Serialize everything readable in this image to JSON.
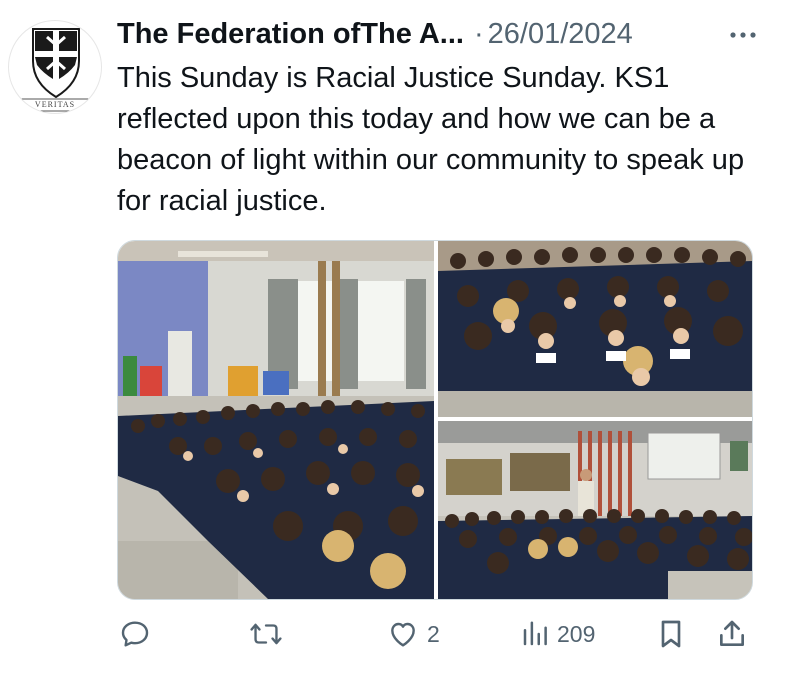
{
  "tweet": {
    "author": "The Federation ofThe A...",
    "separator": "·",
    "date": "26/01/2024",
    "text": "This Sunday is Racial Justice Sunday. KS1 reflected upon this today and how we can be a beacon of light within our community to speak up for racial justice.",
    "avatar": {
      "motto": "VERITAS",
      "icon": "dominican-shield-icon"
    }
  },
  "media": {
    "photos": [
      {
        "icon": "school-hall-photo"
      },
      {
        "icon": "children-praying-photo"
      },
      {
        "icon": "school-assembly-photo"
      }
    ]
  },
  "actions": {
    "reply": {
      "icon": "reply-icon"
    },
    "retweet": {
      "icon": "retweet-icon"
    },
    "like": {
      "icon": "heart-icon",
      "count": "2"
    },
    "views": {
      "icon": "views-icon",
      "count": "209"
    },
    "bookmark": {
      "icon": "bookmark-icon"
    },
    "share": {
      "icon": "share-icon"
    }
  },
  "colors": {
    "text": "#0f1419",
    "secondary": "#536471",
    "border": "#cfd9de",
    "uniform": "#1f2a44"
  }
}
